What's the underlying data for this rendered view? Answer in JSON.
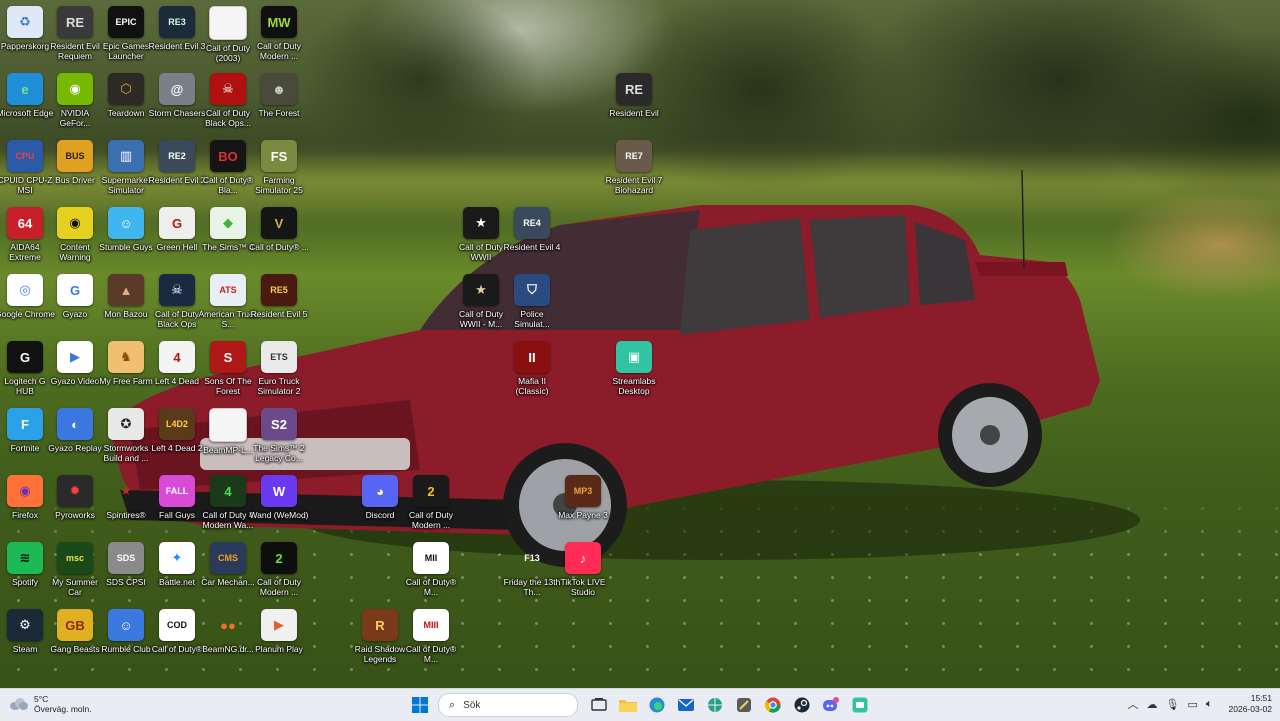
{
  "desktop": {
    "icons": [
      {
        "label": "Papperskorg",
        "name": "recycle-bin-icon",
        "bg": "#dfe9f5",
        "fg": "#3a77c4",
        "glyph": "♻"
      },
      {
        "label": "Resident Evil Requiem",
        "name": "resident-evil-requiem-icon",
        "bg": "#3a3a3a",
        "fg": "#ddd",
        "glyph": "RE"
      },
      {
        "label": "Epic Games Launcher",
        "name": "epic-games-icon",
        "bg": "#111111",
        "fg": "#fff",
        "glyph": "EPIC"
      },
      {
        "label": "Resident Evil 3",
        "name": "resident-evil-3-icon",
        "bg": "#1d2a3a",
        "fg": "#cfd",
        "glyph": "RE3"
      },
      {
        "label": "Call of Duty (2003)",
        "name": "call-of-duty-2003-icon",
        "bg": "blank",
        "fg": "#999",
        "glyph": ""
      },
      {
        "label": "Call of Duty Modern ...",
        "name": "call-of-duty-modern-icon-1",
        "bg": "#101010",
        "fg": "#9fdc2a",
        "glyph": "MW"
      },
      {
        "label": "Microsoft Edge",
        "name": "microsoft-edge-icon",
        "bg": "#1f8fd8",
        "fg": "#7fe08a",
        "glyph": "e"
      },
      {
        "label": "NVIDIA GeFor...",
        "name": "nvidia-geforce-icon",
        "bg": "#76b900",
        "fg": "#fff",
        "glyph": "◉"
      },
      {
        "label": "Teardown",
        "name": "teardown-icon",
        "bg": "#2d2a26",
        "fg": "#e0b040",
        "glyph": "⬡"
      },
      {
        "label": "Storm Chasers",
        "name": "storm-chasers-icon",
        "bg": "#7a7f88",
        "fg": "#fff",
        "glyph": "@"
      },
      {
        "label": "Call of Duty Black Ops...",
        "name": "call-of-duty-black-ops-icon-1",
        "bg": "#b01010",
        "fg": "#fff",
        "glyph": "☠"
      },
      {
        "label": "The Forest",
        "name": "the-forest-icon",
        "bg": "#4a4a3a",
        "fg": "#ccc",
        "glyph": "☻"
      },
      {
        "label": "CPUID CPU-Z MSI",
        "name": "cpu-z-icon",
        "bg": "#2a5aa8",
        "fg": "#f04040",
        "glyph": "CPU"
      },
      {
        "label": "Bus Driver",
        "name": "bus-driver-icon",
        "bg": "#e0a020",
        "fg": "#222",
        "glyph": "BUS"
      },
      {
        "label": "Supermarket Simulator",
        "name": "supermarket-simulator-icon",
        "bg": "#3a6fb0",
        "fg": "#fff",
        "glyph": "▥"
      },
      {
        "label": "Resident Evil 2",
        "name": "resident-evil-2-icon",
        "bg": "#3b4a5a",
        "fg": "#fff",
        "glyph": "RE2"
      },
      {
        "label": "Call of Duty® Bla...",
        "name": "call-of-duty-black-ops-icon-2",
        "bg": "#151515",
        "fg": "#e03030",
        "glyph": "BO"
      },
      {
        "label": "Farming Simulator 25",
        "name": "farming-simulator-icon",
        "bg": "#7a8a40",
        "fg": "#fff",
        "glyph": "FS"
      },
      {
        "label": "AIDA64 Extreme",
        "name": "aida64-icon",
        "bg": "#c8202a",
        "fg": "#fff",
        "glyph": "64"
      },
      {
        "label": "Content Warning",
        "name": "content-warning-icon",
        "bg": "#e6d21e",
        "fg": "#111",
        "glyph": "◉"
      },
      {
        "label": "Stumble Guys",
        "name": "stumble-guys-icon",
        "bg": "#3fb6f0",
        "fg": "#fff",
        "glyph": "☺"
      },
      {
        "label": "Green Hell",
        "name": "green-hell-icon",
        "bg": "#eeeeee",
        "fg": "#c01010",
        "glyph": "G"
      },
      {
        "label": "The Sims™ 4",
        "name": "the-sims-4-icon",
        "bg": "#e8f3e8",
        "fg": "#3cb83c",
        "glyph": "◆"
      },
      {
        "label": "Call of Duty® ...",
        "name": "call-of-duty-icon-1",
        "bg": "#151515",
        "fg": "#d4b24a",
        "glyph": "V"
      },
      {
        "label": "Google Chrome",
        "name": "google-chrome-icon",
        "bg": "#ffffff",
        "fg": "#4285f4",
        "glyph": "◎"
      },
      {
        "label": "Gyazo",
        "name": "gyazo-icon",
        "bg": "#ffffff",
        "fg": "#3a78e0",
        "glyph": "G"
      },
      {
        "label": "Mon Bazou",
        "name": "mon-bazou-icon",
        "bg": "#5a3a28",
        "fg": "#e0b080",
        "glyph": "▲"
      },
      {
        "label": "Call of Duty Black Ops",
        "name": "call-of-duty-black-ops-icon-3",
        "bg": "#1a2a40",
        "fg": "#fff",
        "glyph": "☠"
      },
      {
        "label": "American Truck S...",
        "name": "american-truck-simulator-icon",
        "bg": "#e8eef5",
        "fg": "#c02020",
        "glyph": "ATS"
      },
      {
        "label": "Resident Evil 5",
        "name": "resident-evil-5-icon",
        "bg": "#4a1a10",
        "fg": "#ffcc40",
        "glyph": "RE5"
      },
      {
        "label": "Logitech G HUB",
        "name": "logitech-g-hub-icon",
        "bg": "#111111",
        "fg": "#fff",
        "glyph": "G"
      },
      {
        "label": "Gyazo Video",
        "name": "gyazo-video-icon",
        "bg": "#ffffff",
        "fg": "#3a78e0",
        "glyph": "▶"
      },
      {
        "label": "My Free Farm",
        "name": "my-free-farm-icon",
        "bg": "#f0c070",
        "fg": "#8a4a10",
        "glyph": "♞"
      },
      {
        "label": "Left 4 Dead",
        "name": "left-4-dead-icon",
        "bg": "#f4f4f4",
        "fg": "#c01010",
        "glyph": "4"
      },
      {
        "label": "Sons Of The Forest",
        "name": "sons-of-the-forest-icon",
        "bg": "#b01818",
        "fg": "#fff",
        "glyph": "S"
      },
      {
        "label": "Euro Truck Simulator 2",
        "name": "euro-truck-simulator-icon",
        "bg": "#eaeaea",
        "fg": "#333",
        "glyph": "ETS"
      },
      {
        "label": "Fortnite",
        "name": "fortnite-icon",
        "bg": "#2ba2e8",
        "fg": "#fff",
        "glyph": "F"
      },
      {
        "label": "Gyazo Replay",
        "name": "gyazo-replay-icon",
        "bg": "#3a78e0",
        "fg": "#fff",
        "glyph": "◐"
      },
      {
        "label": "Stormworks Build and ...",
        "name": "stormworks-icon",
        "bg": "#e8e8e8",
        "fg": "#222",
        "glyph": "✪"
      },
      {
        "label": "Left 4 Dead 2",
        "name": "left-4-dead-2-icon",
        "bg": "#5a3a1a",
        "fg": "#ffd040",
        "glyph": "L4D2"
      },
      {
        "label": "BeamMP-L...",
        "name": "beammp-launcher-icon",
        "bg": "blank",
        "fg": "#999",
        "glyph": ""
      },
      {
        "label": "The Sims™ 2 Legacy Co...",
        "name": "the-sims-2-icon",
        "bg": "#6a4a8a",
        "fg": "#fff",
        "glyph": "S2"
      },
      {
        "label": "Firefox",
        "name": "firefox-icon",
        "bg": "#ff7139",
        "fg": "#6a2fb0",
        "glyph": "◉"
      },
      {
        "label": "Pyroworks",
        "name": "pyroworks-icon",
        "bg": "#2a2a2a",
        "fg": "#ff4040",
        "glyph": "✹"
      },
      {
        "label": "Spintires®",
        "name": "spintires-icon",
        "bg": "transparent",
        "fg": "#c02828",
        "glyph": "★"
      },
      {
        "label": "Fall Guys",
        "name": "fall-guys-icon",
        "bg": "#d84ad8",
        "fg": "#fff",
        "glyph": "FALL"
      },
      {
        "label": "Call of Duty 4 Modern Wa...",
        "name": "call-of-duty-4-icon",
        "bg": "#1a3a1a",
        "fg": "#50e050",
        "glyph": "4"
      },
      {
        "label": "Wand (WeMod)",
        "name": "wand-wemod-icon",
        "bg": "#6a3af0",
        "fg": "#fff",
        "glyph": "W"
      },
      {
        "label": "Discord",
        "name": "discord-icon",
        "bg": "#5865f2",
        "fg": "#fff",
        "glyph": "◕"
      },
      {
        "label": "Call of Duty Modern ...",
        "name": "call-of-duty-modern-icon-2",
        "bg": "#1a1a1a",
        "fg": "#f0c020",
        "glyph": "2"
      },
      {
        "label": "Max Payne 3",
        "name": "max-payne-3-icon",
        "bg": "#5a2a18",
        "fg": "#f0a040",
        "glyph": "MP3"
      },
      {
        "label": "Spotify",
        "name": "spotify-icon",
        "bg": "#1db954",
        "fg": "#111",
        "glyph": "≋"
      },
      {
        "label": "My Summer Car",
        "name": "my-summer-car-icon",
        "bg": "#1a4a1a",
        "fg": "#f0e040",
        "glyph": "msc"
      },
      {
        "label": "SDS CPSI",
        "name": "sds-cpsi-icon",
        "bg": "#8a8a8a",
        "fg": "#fff",
        "glyph": "SDS"
      },
      {
        "label": "Battle.net",
        "name": "battle-net-icon",
        "bg": "#ffffff",
        "fg": "#148eff",
        "glyph": "✦"
      },
      {
        "label": "Car Mechan...",
        "name": "car-mechanic-icon",
        "bg": "#2a3a5a",
        "fg": "#f0a020",
        "glyph": "CMS"
      },
      {
        "label": "Call of Duty Modern ...",
        "name": "call-of-duty-modern-icon-3",
        "bg": "#0e0e0e",
        "fg": "#6fdc3a",
        "glyph": "2"
      },
      {
        "label": "Call of Duty® M...",
        "name": "call-of-duty-mw-icon-1",
        "bg": "#ffffff",
        "fg": "#111",
        "glyph": "MII"
      },
      {
        "label": "Friday the 13th Th...",
        "name": "friday-the-13th-icon",
        "bg": "transparent",
        "fg": "#fff",
        "glyph": "F13"
      },
      {
        "label": "TikTok LIVE Studio",
        "name": "tiktok-live-studio-icon",
        "bg": "#fe2c55",
        "fg": "#fff",
        "glyph": "♪"
      },
      {
        "label": "Steam",
        "name": "steam-icon",
        "bg": "#1b2838",
        "fg": "#fff",
        "glyph": "⚙"
      },
      {
        "label": "Gang Beasts",
        "name": "gang-beasts-icon",
        "bg": "#e0b020",
        "fg": "#8a2a10",
        "glyph": "GB"
      },
      {
        "label": "Rumble Club",
        "name": "rumble-club-icon",
        "bg": "#3a7ae0",
        "fg": "#fff",
        "glyph": "☺"
      },
      {
        "label": "Call of Duty®",
        "name": "call-of-duty-icon-2",
        "bg": "#ffffff",
        "fg": "#111",
        "glyph": "COD"
      },
      {
        "label": "BeamNG.dr...",
        "name": "beamng-drive-icon",
        "bg": "transparent",
        "fg": "#f07020",
        "glyph": "●●"
      },
      {
        "label": "Planum Play",
        "name": "planum-play-icon",
        "bg": "#f0f0f0",
        "fg": "#e06030",
        "glyph": "▶"
      },
      {
        "label": "Raid Shadow Legends",
        "name": "raid-shadow-legends-icon",
        "bg": "#7a3a1a",
        "fg": "#ffd060",
        "glyph": "R"
      },
      {
        "label": "Call of Duty® M...",
        "name": "call-of-duty-mw-icon-2",
        "bg": "#ffffff",
        "fg": "#c01010",
        "glyph": "MIII"
      },
      {
        "label": "Call of Duty WWII",
        "name": "call-of-duty-wwii-icon-1",
        "bg": "#1a1a1a",
        "fg": "#fff",
        "glyph": "★"
      },
      {
        "label": "Resident Evil 4",
        "name": "resident-evil-4-icon",
        "bg": "#3a4a5a",
        "fg": "#fff",
        "glyph": "RE4"
      },
      {
        "label": "Call of Duty WWII - M...",
        "name": "call-of-duty-wwii-icon-2",
        "bg": "#1a1a1a",
        "fg": "#e0d0a0",
        "glyph": "★"
      },
      {
        "label": "Police Simulat...",
        "name": "police-simulator-icon",
        "bg": "#2a4a80",
        "fg": "#fff",
        "glyph": "⛉"
      },
      {
        "label": "Mafia II (Classic)",
        "name": "mafia-2-icon",
        "bg": "#8a1010",
        "fg": "#fff",
        "glyph": "II"
      },
      {
        "label": "Streamlabs Desktop",
        "name": "streamlabs-icon",
        "bg": "#31c3a2",
        "fg": "#fff",
        "glyph": "▣"
      },
      {
        "label": "Resident Evil",
        "name": "resident-evil-icon",
        "bg": "#2a2a2a",
        "fg": "#ddd",
        "glyph": "RE"
      },
      {
        "label": "Resident Evil 7 Biohazard",
        "name": "resident-evil-7-icon",
        "bg": "#6a5a4a",
        "fg": "#fff",
        "glyph": "RE7"
      }
    ]
  },
  "taskbar": {
    "weather": {
      "temp": "5°C",
      "desc": "Överväg. moln."
    },
    "search_label": "Sök",
    "apps": [
      {
        "name": "start-button",
        "icon": "windows-icon"
      },
      {
        "name": "task-view-button",
        "icon": "task-view-icon"
      },
      {
        "name": "file-explorer-button",
        "icon": "folder-icon"
      },
      {
        "name": "edge-button",
        "icon": "edge-icon"
      },
      {
        "name": "outlook-button",
        "icon": "mail-icon"
      },
      {
        "name": "browser-button",
        "icon": "globe-icon"
      },
      {
        "name": "app-button",
        "icon": "app-icon"
      },
      {
        "name": "chrome-button",
        "icon": "chrome-icon"
      },
      {
        "name": "steam-button",
        "icon": "steam-icon"
      },
      {
        "name": "discord-button",
        "icon": "discord-icon"
      },
      {
        "name": "streamlabs-button",
        "icon": "streamlabs-icon"
      }
    ],
    "time": "15:51",
    "date": "2026-03-02"
  }
}
